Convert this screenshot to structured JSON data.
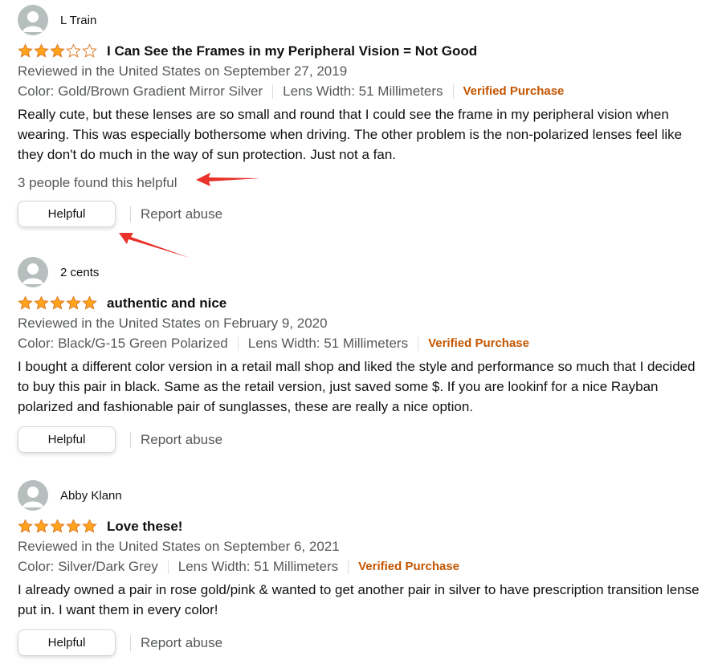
{
  "colors": {
    "star": "#ffa41c",
    "verified": "#c45500",
    "annotation_arrow": "#e8322a"
  },
  "reviews": [
    {
      "profile_name": "L Train",
      "rating": 3,
      "rating_max": 5,
      "title": "I Can See the Frames in my Peripheral Vision = Not Good",
      "date_line": "Reviewed in the United States on September 27, 2019",
      "color": "Color: Gold/Brown Gradient Mirror Silver",
      "lens_width": "Lens Width: 51 Millimeters",
      "verified": "Verified Purchase",
      "body": "Really cute, but these lenses are so small and round that I could see the frame in my peripheral vision when wearing. This was especially bothersome when driving. The other problem is the non-polarized lenses feel like they don't do much in the way of sun protection. Just not a fan.",
      "helpful_count": "3 people found this helpful",
      "helpful_label": "Helpful",
      "report_label": "Report abuse"
    },
    {
      "profile_name": "2 cents",
      "rating": 5,
      "rating_max": 5,
      "title": "authentic and nice",
      "date_line": "Reviewed in the United States on February 9, 2020",
      "color": "Color: Black/G-15 Green Polarized",
      "lens_width": "Lens Width: 51 Millimeters",
      "verified": "Verified Purchase",
      "body": "I bought a different color version in a retail mall shop and liked the style and performance so much that I decided to buy this pair in black. Same as the retail version, just saved some $. If you are lookinf for a nice Rayban polarized and fashionable pair of sunglasses, these are really a nice option.",
      "helpful_label": "Helpful",
      "report_label": "Report abuse"
    },
    {
      "profile_name": "Abby Klann",
      "rating": 5,
      "rating_max": 5,
      "title": "Love these!",
      "date_line": "Reviewed in the United States on September 6, 2021",
      "color": "Color: Silver/Dark Grey",
      "lens_width": "Lens Width: 51 Millimeters",
      "verified": "Verified Purchase",
      "body": "I already owned a pair in rose gold/pink & wanted to get another pair in silver to have prescription transition lense put in. I want them in every color!",
      "helpful_label": "Helpful",
      "report_label": "Report abuse"
    }
  ]
}
